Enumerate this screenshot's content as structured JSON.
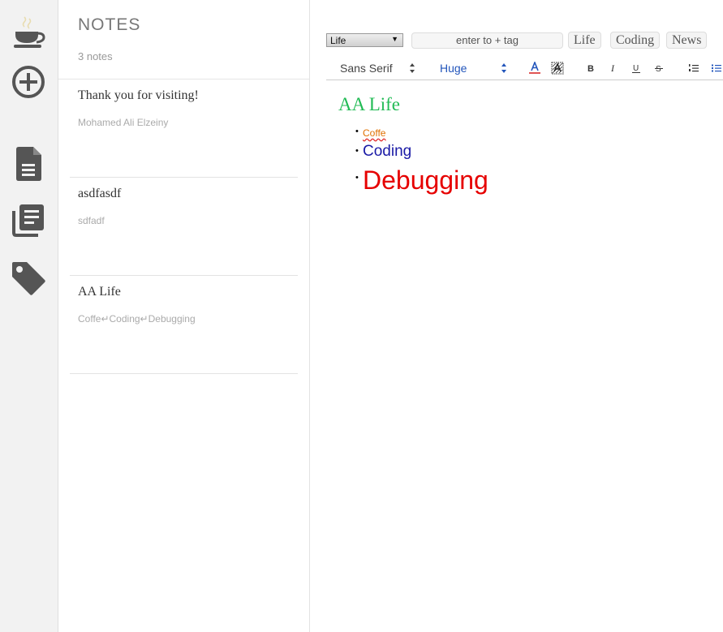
{
  "sidebar_icons": [
    "coffee-cup-icon",
    "plus-circle-icon",
    "document-icon",
    "notebooks-icon",
    "tag-icon"
  ],
  "notes": {
    "title": "NOTES",
    "count": "3 notes",
    "items": [
      {
        "title": "Thank you for visiting!",
        "preview": "Mohamed Ali Elzeiny"
      },
      {
        "title": "asdfasdf",
        "preview": "sdfadf"
      },
      {
        "title": "AA Life",
        "preview": "Coffe↵Coding↵Debugging"
      }
    ]
  },
  "editor": {
    "notebook_select": "Life",
    "tag_input_placeholder": "enter to + tag",
    "tags": [
      "Life",
      "Coding",
      "News"
    ],
    "toolbar": {
      "font": "Sans Serif",
      "size": "Huge",
      "buttons": [
        "text-color-icon",
        "background-color-icon",
        "bold-icon",
        "italic-icon",
        "underline-icon",
        "strikethrough-icon",
        "ordered-list-icon",
        "bullet-list-icon"
      ]
    },
    "content": {
      "heading": "AA Life",
      "list": [
        "Coffe",
        "Coding",
        "Debugging"
      ]
    }
  },
  "colors": {
    "heading": "#22bb55",
    "coffe": "#e07000",
    "coding": "#1a1aa6",
    "debugging": "#e60000",
    "accent": "#2255bb"
  }
}
